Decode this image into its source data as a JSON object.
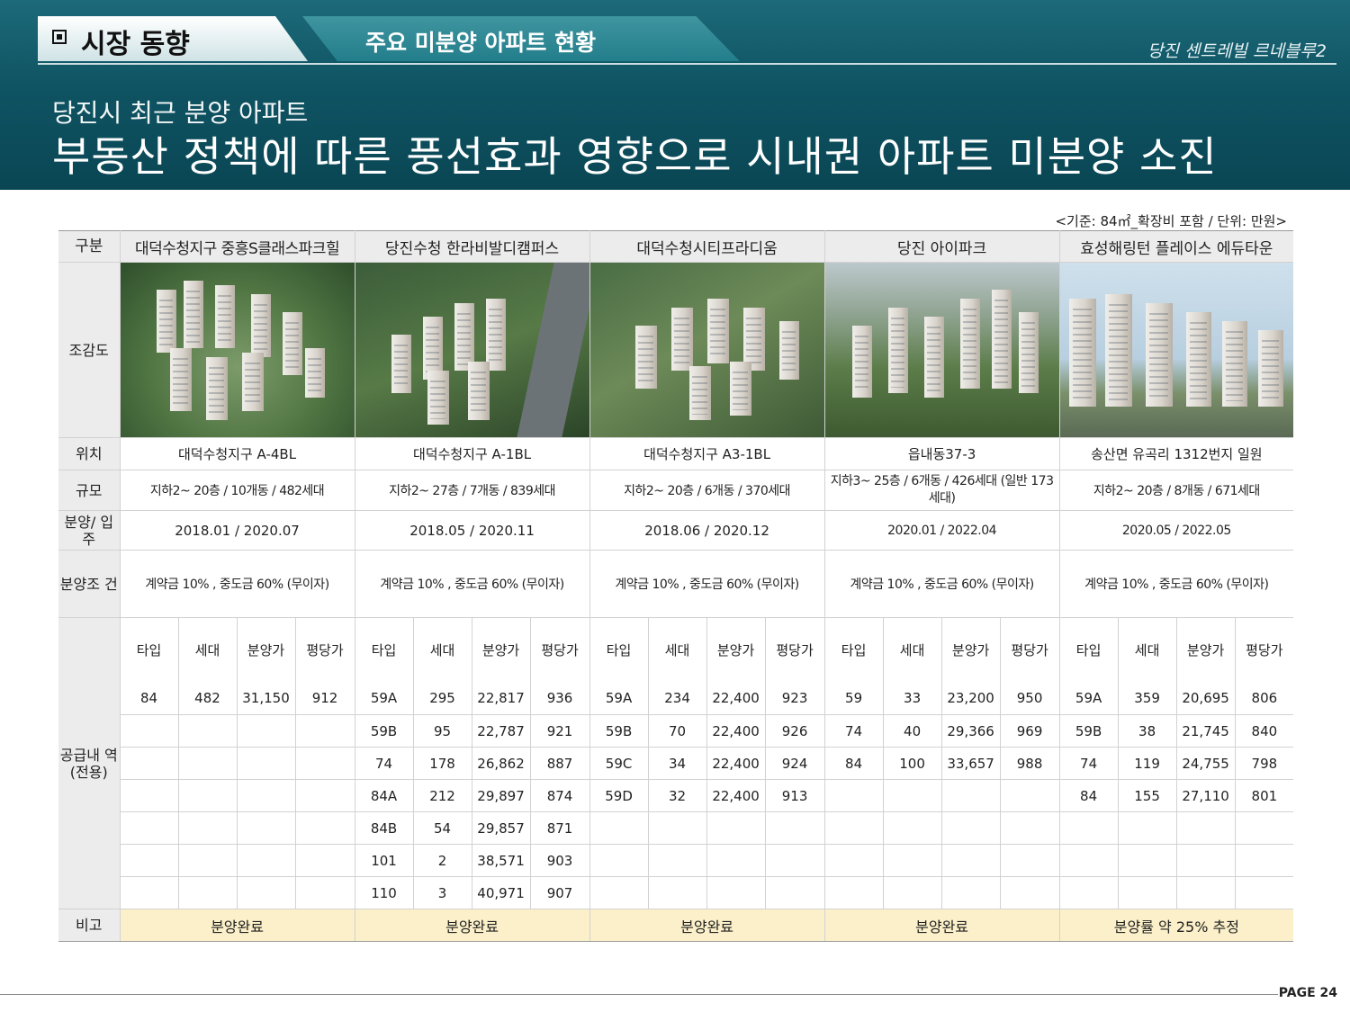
{
  "header": {
    "section": "시장 동향",
    "subsection": "주요 미분양 아파트 현황",
    "project": "당진 센트레빌 르네블루2",
    "subtitle": "당진시 최근 분양 아파트",
    "headline": "부동산 정책에 따른 풍선효과 영향으로 시내권 아파트 미분양 소진"
  },
  "note": "<기준: 84㎡_확장비 포함 / 단위: 만원>",
  "row_labels": {
    "category": "구분",
    "view": "조감도",
    "location": "위치",
    "scale": "규모",
    "schedule": "분양/ 입주",
    "terms": "분양조 건",
    "supply": "공급내 역 (전용)",
    "remark": "비고"
  },
  "subheaders": [
    "타입",
    "세대",
    "분양가",
    "평당가"
  ],
  "complexes": [
    {
      "name": "대덕수청지구 중흥S클래스파크힐",
      "location": "대덕수청지구 A-4BL",
      "scale": "지하2~ 20층 / 10개동 / 482세대",
      "schedule": "2018.01 / 2020.07",
      "terms": "계약금 10% , 중도금 60% (무이자)",
      "rows": [
        [
          "84",
          "482",
          "31,150",
          "912"
        ]
      ],
      "remark": "분양완료"
    },
    {
      "name": "당진수청 한라비발디캠퍼스",
      "location": "대덕수청지구 A-1BL",
      "scale": "지하2~ 27층 / 7개동 / 839세대",
      "schedule": "2018.05 / 2020.11",
      "terms": "계약금 10% , 중도금 60% (무이자)",
      "rows": [
        [
          "59A",
          "295",
          "22,817",
          "936"
        ],
        [
          "59B",
          "95",
          "22,787",
          "921"
        ],
        [
          "74",
          "178",
          "26,862",
          "887"
        ],
        [
          "84A",
          "212",
          "29,897",
          "874"
        ],
        [
          "84B",
          "54",
          "29,857",
          "871"
        ],
        [
          "101",
          "2",
          "38,571",
          "903"
        ],
        [
          "110",
          "3",
          "40,971",
          "907"
        ]
      ],
      "remark": "분양완료"
    },
    {
      "name": "대덕수청시티프라디움",
      "location": "대덕수청지구 A3-1BL",
      "scale": "지하2~ 20층 / 6개동 / 370세대",
      "schedule": "2018.06 /  2020.12",
      "terms": "계약금 10% , 중도금 60% (무이자)",
      "rows": [
        [
          "59A",
          "234",
          "22,400",
          "923"
        ],
        [
          "59B",
          "70",
          "22,400",
          "926"
        ],
        [
          "59C",
          "34",
          "22,400",
          "924"
        ],
        [
          "59D",
          "32",
          "22,400",
          "913"
        ]
      ],
      "remark": "분양완료"
    },
    {
      "name": "당진 아이파크",
      "location": "읍내동37-3",
      "scale": "지하3~ 25층 / 6개동 / 426세대 (일반 173세대)",
      "schedule": "2020.01 / 2022.04",
      "terms": "계약금 10% , 중도금 60% (무이자)",
      "rows": [
        [
          "59",
          "33",
          "23,200",
          "950"
        ],
        [
          "74",
          "40",
          "29,366",
          "969"
        ],
        [
          "84",
          "100",
          "33,657",
          "988"
        ]
      ],
      "remark": "분양완료"
    },
    {
      "name": "효성해링턴 플레이스 에듀타운",
      "location": "송산면 유곡리 1312번지 일원",
      "scale": "지하2~ 20층 / 8개동 / 671세대",
      "schedule": "2020.05 / 2022.05",
      "terms": "계약금 10% , 중도금 60% (무이자)",
      "rows": [
        [
          "59A",
          "359",
          "20,695",
          "806"
        ],
        [
          "59B",
          "38",
          "21,745",
          "840"
        ],
        [
          "74",
          "119",
          "24,755",
          "798"
        ],
        [
          "84",
          "155",
          "27,110",
          "801"
        ]
      ],
      "remark": "분양률 약 25% 추정"
    }
  ],
  "page": "PAGE 24",
  "colors": {
    "header_teal": "#0f5463",
    "remark_fill": "#fbf0c9",
    "label_fill": "#ececec"
  }
}
